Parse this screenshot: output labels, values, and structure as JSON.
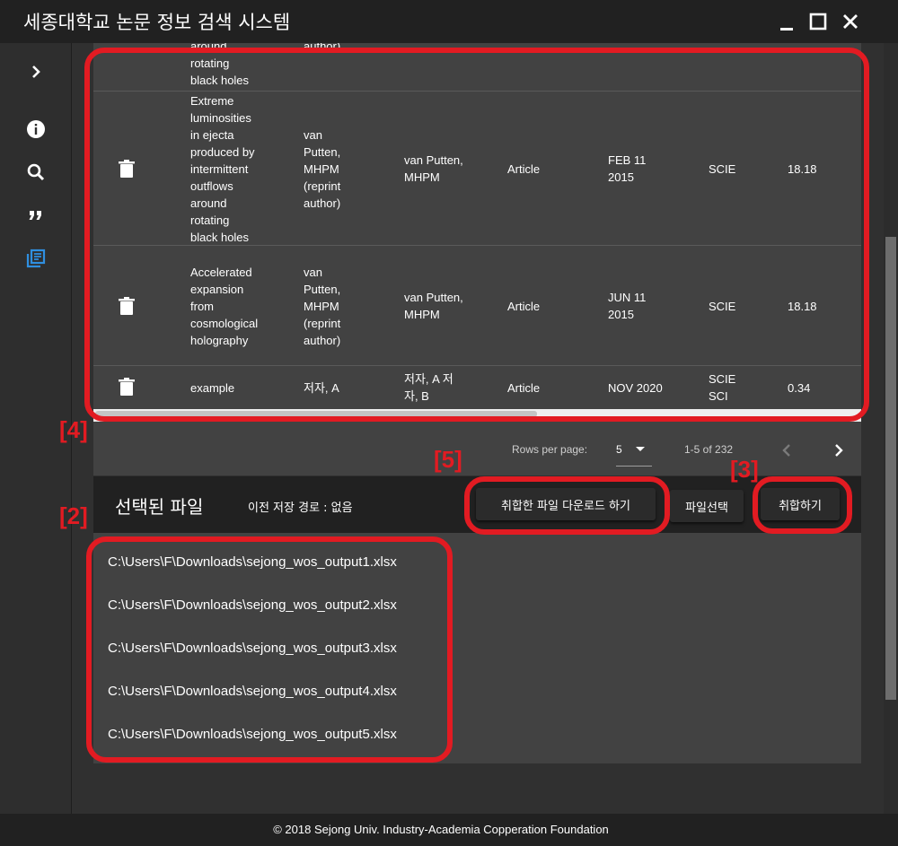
{
  "window": {
    "title": "세종대학교 논문 정보 검색 시스템"
  },
  "sidebar": {
    "icons": [
      "chevron-right-icon",
      "info-icon",
      "search-icon",
      "quote-icon",
      "library-books-icon"
    ]
  },
  "table": {
    "rows": [
      {
        "title": "around\nrotating\nblack holes",
        "author": "author)",
        "authors": "",
        "type": "",
        "date": "",
        "index": "",
        "if": ""
      },
      {
        "title": "Extreme\nluminosities\nin ejecta\nproduced by\nintermittent\noutflows\naround\nrotating\nblack holes",
        "author": "van\nPutten,\nMHPM\n(reprint\nauthor)",
        "authors": "van Putten,\nMHPM",
        "type": "Article",
        "date": "FEB 11\n2015",
        "index": "SCIE",
        "if": "18.18"
      },
      {
        "title": "Accelerated\nexpansion\nfrom\ncosmological\nholography",
        "author": "van\nPutten,\nMHPM\n(reprint\nauthor)",
        "authors": "van Putten,\nMHPM",
        "type": "Article",
        "date": "JUN 11\n2015",
        "index": "SCIE",
        "if": "18.18"
      },
      {
        "title": "example",
        "author": "저자, A",
        "authors": "저자, A 저\n자, B",
        "type": "Article",
        "date": "NOV 2020",
        "index": "SCIE\nSCI",
        "if": "0.34"
      }
    ]
  },
  "pagination": {
    "rows_per_page_label": "Rows per page:",
    "rows_per_page": "5",
    "range": "1-5 of 232"
  },
  "files": {
    "title": "선택된 파일",
    "prev_path": "이전 저장 경로 : 없음",
    "download_button": "취합한 파일 다운로드 하기",
    "select_button": "파일선택",
    "merge_button": "취합하기",
    "items": [
      "C:\\Users\\F\\Downloads\\sejong_wos_output1.xlsx",
      "C:\\Users\\F\\Downloads\\sejong_wos_output2.xlsx",
      "C:\\Users\\F\\Downloads\\sejong_wos_output3.xlsx",
      "C:\\Users\\F\\Downloads\\sejong_wos_output4.xlsx",
      "C:\\Users\\F\\Downloads\\sejong_wos_output5.xlsx"
    ]
  },
  "annotations": {
    "label_2": "[2]",
    "label_3": "[3]",
    "label_4": "[4]",
    "label_5": "[5]",
    "color": "#e21b22"
  },
  "footer": {
    "text": "© 2018 Sejong Univ. Industry-Academia Copperation Foundation"
  }
}
